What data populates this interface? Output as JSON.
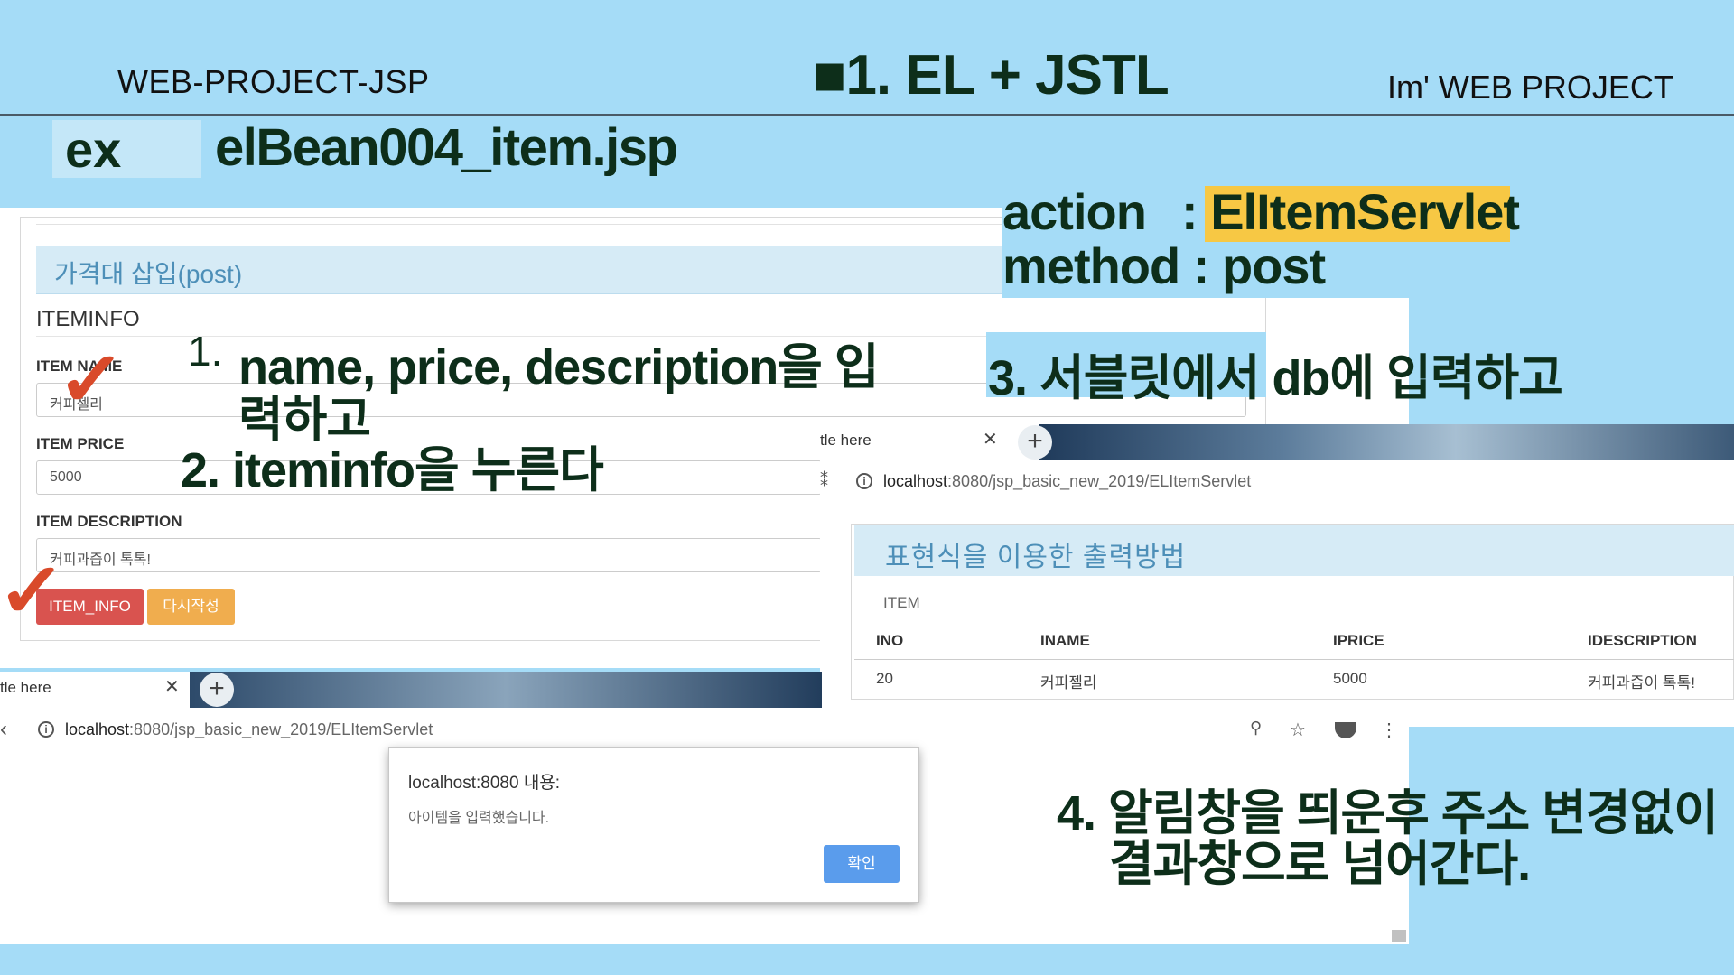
{
  "header": {
    "left": "WEB-PROJECT-JSP",
    "center": "■1. EL + JSTL",
    "right": "Im'  WEB PROJECT",
    "ex": "ex",
    "filename": "elBean004_item.jsp"
  },
  "form": {
    "heading": "가격대 삽입(post)",
    "section": "ITEMINFO",
    "name_label": "ITEM NAME",
    "name_value": "커피젤리",
    "price_label": "ITEM PRICE",
    "price_value": "5000",
    "desc_label": "ITEM DESCRIPTION",
    "desc_value": "커피과즙이 톡톡!",
    "submit": "ITEM_INFO",
    "reset": "다시작성"
  },
  "annotations": {
    "action_label": "action",
    "action_value": ": ElItemServlet",
    "method_line": "method : post",
    "step1_num": "1.",
    "step1_a": "name, price, description을 입",
    "step1_b": "력하고",
    "step2": "2.  iteminfo을 누른다",
    "step3": "3. 서블릿에서   db에 입력하고",
    "step4_a": "4. 알림창을 띄운후 주소 변경없이",
    "step4_b": "결과창으로 넘어간다."
  },
  "result_browser": {
    "tab_title": "tle here",
    "url_host": "localhost",
    "url_path": ":8080/jsp_basic_new_2019/ELItemServlet",
    "heading": "표현식을 이용한 출력방법",
    "caption": "ITEM",
    "columns": [
      "INO",
      "INAME",
      "IPRICE",
      "IDESCRIPTION"
    ],
    "row": [
      "20",
      "커피젤리",
      "5000",
      "커피과즙이 톡톡!"
    ]
  },
  "alert_browser": {
    "tab_title": "tle here",
    "url_host": "localhost",
    "url_path": ":8080/jsp_basic_new_2019/ELItemServlet",
    "alert_title": "localhost:8080 내용:",
    "alert_message": "아이템을 입력했습니다.",
    "ok": "확인"
  },
  "icons": [
    "info-icon",
    "close-icon",
    "plus-icon",
    "back-arrow-icon",
    "search-icon",
    "star-icon",
    "extension-icon",
    "menu-icon",
    "check-mark-icon"
  ],
  "colors": {
    "background": "#a5dcf7",
    "title_text": "#0d2e1a",
    "highlight": "#f7c844",
    "btn_submit": "#d9534f",
    "btn_reset": "#f0ad4e",
    "heading_blue": "#4d8fb8",
    "alert_ok": "#5a9cec"
  }
}
